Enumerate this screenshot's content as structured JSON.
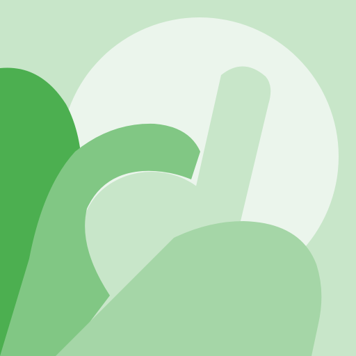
{
  "artwork": {
    "icon": "abstract-green-letter-d-icon",
    "colors": {
      "background": "#C8E6C9",
      "circle": "#EBF5EC",
      "dark_shape": "#4CAF50",
      "mid_shape": "#81C784",
      "light_shape": "#A5D6A7",
      "pale_shape": "#C8E6C9"
    }
  }
}
